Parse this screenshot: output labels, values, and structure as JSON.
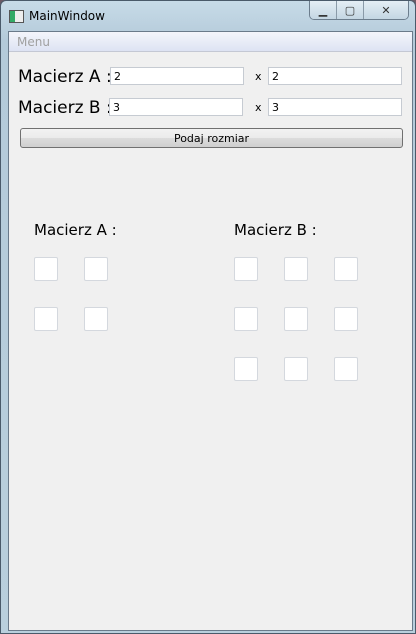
{
  "window": {
    "title": "MainWindow"
  },
  "menu": {
    "items": [
      "Menu"
    ]
  },
  "form": {
    "matrix_a_label": "Macierz A :",
    "matrix_a_rows": "2",
    "matrix_a_cols": "2",
    "matrix_b_label": "Macierz B :",
    "matrix_b_rows": "3",
    "matrix_b_cols": "3",
    "times": "x",
    "submit_label": "Podaj rozmiar"
  },
  "grids": {
    "a_label": "Macierz A :",
    "a_size": [
      2,
      2
    ],
    "b_label": "Macierz B :",
    "b_size": [
      3,
      3
    ]
  }
}
